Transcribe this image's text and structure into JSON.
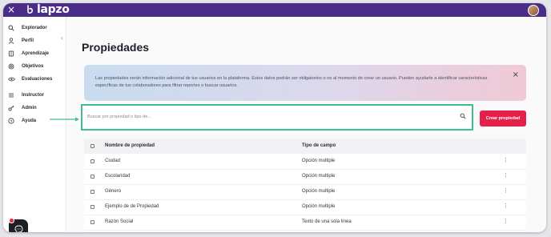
{
  "header": {
    "close_glyph": "×",
    "logo_text": "lapzo",
    "colors": {
      "topbar": "#4a2d88"
    }
  },
  "sidebar": {
    "items": [
      {
        "label": "Explorador",
        "icon": "search-icon"
      },
      {
        "label": "Perfil",
        "icon": "person-icon"
      },
      {
        "label": "Aprendizaje",
        "icon": "book-icon"
      },
      {
        "label": "Objetivos",
        "icon": "target-icon"
      },
      {
        "label": "Evaluaciones",
        "icon": "eye-icon"
      },
      {
        "label": "Instructor",
        "icon": "list-icon"
      },
      {
        "label": "Admin",
        "icon": "key-icon"
      },
      {
        "label": "Ayuda",
        "icon": "help-icon"
      }
    ],
    "collapse_glyph": "‹"
  },
  "main": {
    "title": "Propiedades",
    "banner": {
      "text": "Las propiedades serán información adicional de tus usuarios en la plataforma. Estos datos podrán ser obligatorios o no al momento de crear un usuario. Pueden ayudarte a identificar características específicas de tus colaboradores para filtrar reportes o buscar usuarios.",
      "close_glyph": "×"
    },
    "search": {
      "placeholder": "Buscar por propiedad o tipo de...",
      "value": ""
    },
    "create_button": {
      "label": "Crear propiedad",
      "color": "#e5214a"
    },
    "table": {
      "columns": [
        "Nombre de propiedad",
        "Tipo de campo"
      ],
      "rows": [
        {
          "name": "Ciudad",
          "type": "Opción multiple"
        },
        {
          "name": "Escolaridad",
          "type": "Opción multiple"
        },
        {
          "name": "Género",
          "type": "Opción multiple"
        },
        {
          "name": "Ejemplo de de Propiedad",
          "type": "Opción multiple"
        },
        {
          "name": "Razón Social",
          "type": "Texto de una sola línea"
        }
      ],
      "row_menu_glyph": "⋮"
    }
  }
}
